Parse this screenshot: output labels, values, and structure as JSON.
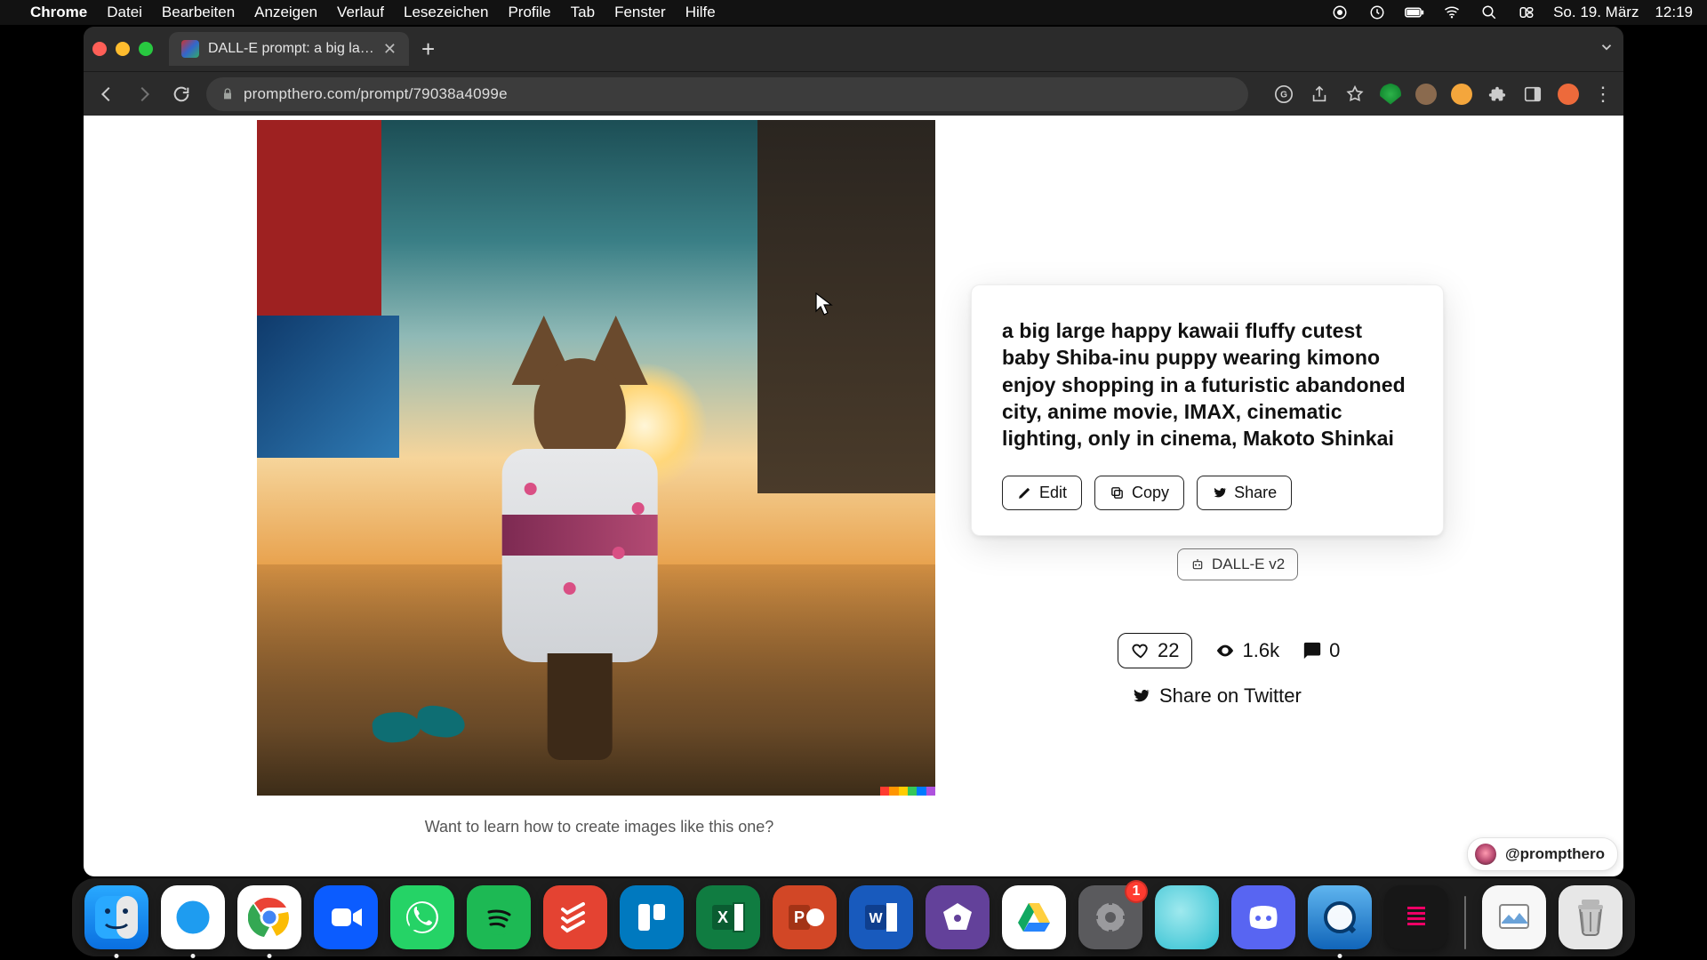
{
  "menubar": {
    "app": "Chrome",
    "items": [
      "Datei",
      "Bearbeiten",
      "Anzeigen",
      "Verlauf",
      "Lesezeichen",
      "Profile",
      "Tab",
      "Fenster",
      "Hilfe"
    ],
    "date": "So. 19. März",
    "time": "12:19"
  },
  "browser": {
    "tab_title": "DALL-E prompt: a big large ha",
    "url": "prompthero.com/prompt/79038a4099e"
  },
  "prompt": {
    "text": "a big large happy kawaii fluffy cutest baby Shiba-inu puppy wearing kimono enjoy shopping in a futuristic abandoned city, anime movie, IMAX, cinematic lighting, only in cinema, Makoto Shinkai",
    "edit_label": "Edit",
    "copy_label": "Copy",
    "share_label": "Share"
  },
  "model_chip": "DALL-E v2",
  "stats": {
    "likes": "22",
    "views": "1.6k",
    "comments": "0"
  },
  "share_twitter": "Share on Twitter",
  "learn_text": "Want to learn how to create images like this one?",
  "handle": "@prompthero",
  "dock": {
    "settings_badge": "1"
  }
}
